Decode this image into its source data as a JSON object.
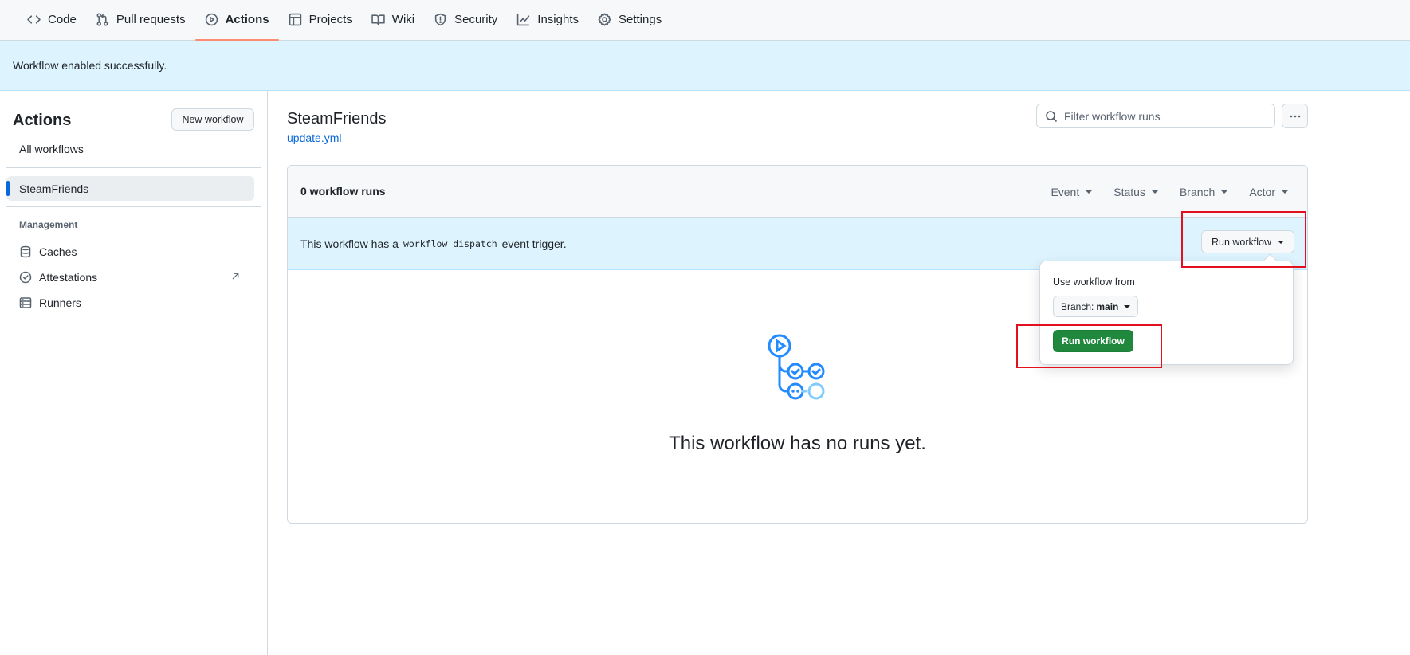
{
  "repo_nav": {
    "tabs": [
      {
        "label": "Code",
        "icon": "code-icon"
      },
      {
        "label": "Pull requests",
        "icon": "pull-request-icon"
      },
      {
        "label": "Actions",
        "icon": "play-icon",
        "active": true
      },
      {
        "label": "Projects",
        "icon": "table-icon"
      },
      {
        "label": "Wiki",
        "icon": "book-icon"
      },
      {
        "label": "Security",
        "icon": "shield-icon"
      },
      {
        "label": "Insights",
        "icon": "graph-icon"
      },
      {
        "label": "Settings",
        "icon": "gear-icon"
      }
    ]
  },
  "flash": {
    "message": "Workflow enabled successfully."
  },
  "sidebar": {
    "title": "Actions",
    "new_workflow": "New workflow",
    "all_workflows": "All workflows",
    "active_workflow": "SteamFriends",
    "management_heading": "Management",
    "items": [
      {
        "label": "Caches",
        "icon": "database-icon"
      },
      {
        "label": "Attestations",
        "icon": "verified-icon"
      },
      {
        "label": "Runners",
        "icon": "server-icon"
      }
    ]
  },
  "main": {
    "title": "SteamFriends",
    "file": "update.yml",
    "filter_placeholder": "Filter workflow runs",
    "run_count": "0 workflow runs",
    "filters": [
      "Event",
      "Status",
      "Branch",
      "Actor"
    ],
    "dispatch_prefix": "This workflow has a",
    "dispatch_code": "workflow_dispatch",
    "dispatch_suffix": "event trigger.",
    "run_workflow_dropdown": "Run workflow",
    "empty_message": "This workflow has no runs yet."
  },
  "popover": {
    "label": "Use workflow from",
    "branch_prefix": "Branch:",
    "branch_name": "main",
    "run_button": "Run workflow"
  },
  "colors": {
    "accent_blue": "#0969da",
    "primary_green": "#1f883d",
    "highlight_red": "#e3101d",
    "active_tab_underline": "#fd8c73"
  }
}
